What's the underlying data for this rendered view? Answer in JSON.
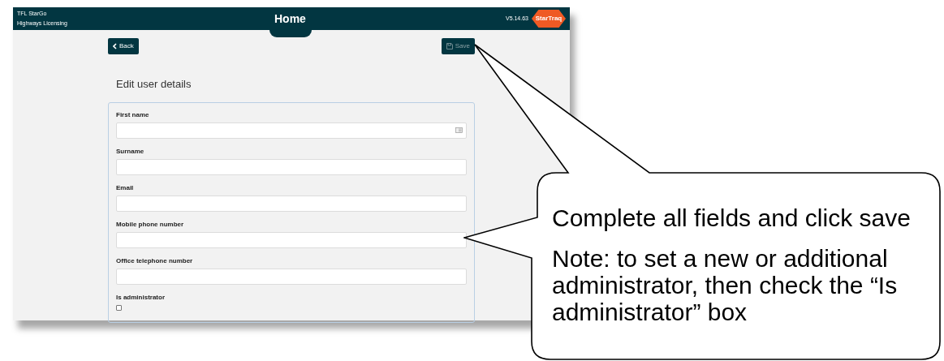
{
  "header": {
    "org": "TFL StarGo",
    "product": "Highways Licensing",
    "title": "Home",
    "version": "V5.14.63",
    "logo": "StarTraq"
  },
  "toolbar": {
    "back": "Back",
    "save": "Save",
    "save_disabled": true
  },
  "form": {
    "title": "Edit user details",
    "fields": [
      {
        "kind": "text",
        "label": "First name",
        "autofill_icon": true
      },
      {
        "kind": "text",
        "label": "Surname"
      },
      {
        "kind": "text",
        "label": "Email"
      },
      {
        "kind": "text",
        "label": "Mobile phone number"
      },
      {
        "kind": "text",
        "label": "Office telephone number"
      },
      {
        "kind": "checkbox",
        "label": "Is administrator",
        "checked": false
      }
    ]
  },
  "callout": {
    "paragraphs": [
      "Complete all fields and click save",
      "Note: to set a new or additional administrator, then check the “Is administrator” box"
    ]
  }
}
